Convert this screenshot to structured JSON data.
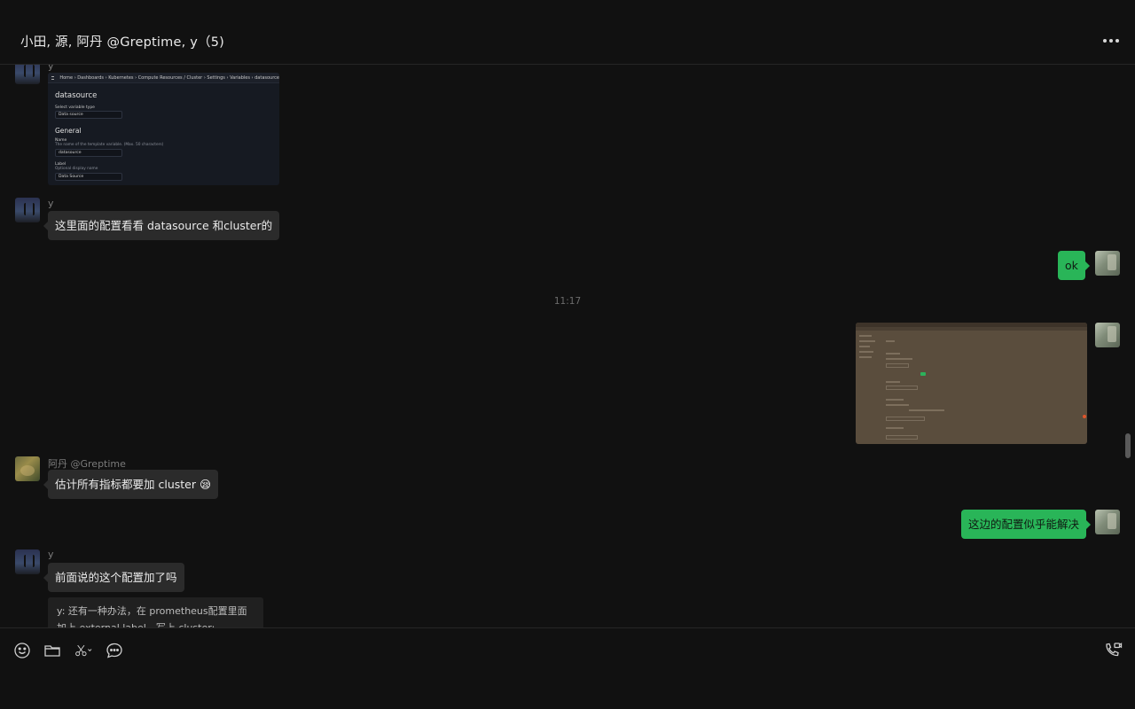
{
  "header": {
    "title": "小田, 源, 阿丹 @Greptime, y（5)",
    "more_icon": "more-icon"
  },
  "screenshot_card": {
    "breadcrumb": "Home  ›  Dashboards  ›  Kubernetes  ›  Compute Resources / Cluster  ›  Settings  ›  Variables  ›  datasource",
    "heading": "datasource",
    "select_label": "Select variable type",
    "select_value": "Data source",
    "section": "General",
    "name_label": "Name",
    "name_help": "The name of the template variable. (Max. 50 characters)",
    "name_value": "datasource",
    "label_label": "Label",
    "label_help": "Optional display name",
    "label_value": "Data Source"
  },
  "messages": {
    "sender_y": "y",
    "msg1": "这里面的配置看看 datasource 和cluster的",
    "msg_ok": "ok",
    "time": "11:17",
    "sender_adan": "阿丹 @Greptime",
    "msg_adan": "估计所有指标都要加 cluster 😪",
    "msg_me2": "这边的配置似乎能解决",
    "msg_y2": "前面说的这个配置加了吗",
    "quote": "y: 还有一种办法，在 prometheus配置里面加上 external label，写上 cluster: test_cluster"
  },
  "colors": {
    "background": "#111111",
    "bubble_in": "#2b2b2b",
    "bubble_out": "#29b558"
  },
  "toolbar": {
    "emoji": "emoji-icon",
    "folder": "folder-icon",
    "scissors": "scissors-icon",
    "chat": "chat-bubble-icon",
    "call": "phone-video-icon"
  }
}
